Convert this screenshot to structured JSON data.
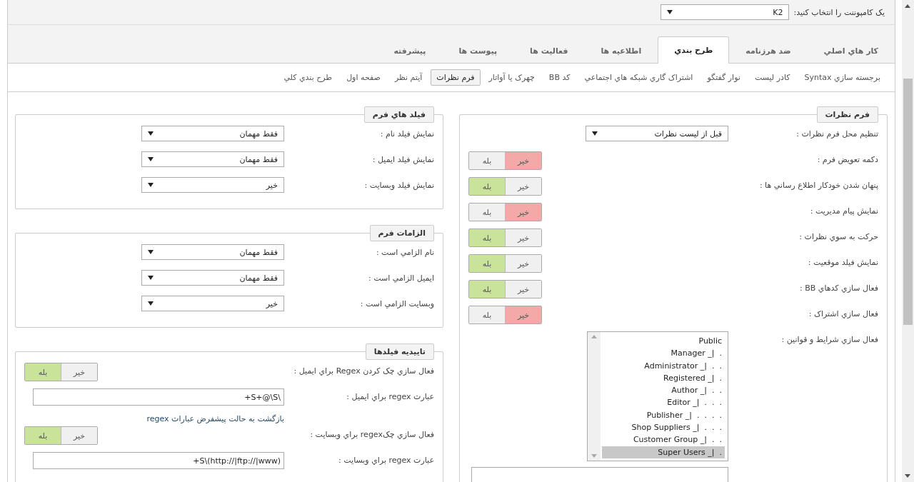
{
  "component_picker": {
    "label": "يک کامپوننت را انتخاب کنيد:",
    "value": "K2"
  },
  "tabs": [
    {
      "label": "کار هاي اصلي",
      "selected": false
    },
    {
      "label": "ضد هرزنامه",
      "selected": false
    },
    {
      "label": "طرح بندي",
      "selected": true
    },
    {
      "label": "اطلاعيه ها",
      "selected": false
    },
    {
      "label": "فعاليت ها",
      "selected": false
    },
    {
      "label": "پيوست ها",
      "selected": false
    },
    {
      "label": "پيشرفته",
      "selected": false
    }
  ],
  "subtabs": [
    {
      "label": "برجسته سازي Syntax",
      "selected": false
    },
    {
      "label": "کادر ليست",
      "selected": false
    },
    {
      "label": "نوار گفتگو",
      "selected": false
    },
    {
      "label": "اشتراک گاري شبکه هاي اجتماعي",
      "selected": false
    },
    {
      "label": "کد BB",
      "selected": false
    },
    {
      "label": "چهرک يا آواتار",
      "selected": false
    },
    {
      "label": "فرم نظرات",
      "selected": true
    },
    {
      "label": "آيتم نظر",
      "selected": false
    },
    {
      "label": "صفحه اول",
      "selected": false
    },
    {
      "label": "طرح بندي کلي",
      "selected": false
    }
  ],
  "right_column": [
    {
      "legend": "فرم نظرات",
      "rows": [
        {
          "kind": "select",
          "label": "تنظيم محل فرم نظرات :",
          "value": "قبل از ليست نظرات"
        },
        {
          "kind": "toggle",
          "label": "دکمه تعويض فرم :",
          "options": [
            {
              "label": "خير",
              "selected": true
            },
            {
              "label": "بله",
              "selected": false
            }
          ]
        },
        {
          "kind": "toggle",
          "label": "پنهان شدن خودکار اطلاع رساني ها :",
          "options": [
            {
              "label": "خير",
              "selected": false
            },
            {
              "label": "بله",
              "selected": true
            }
          ]
        },
        {
          "kind": "toggle",
          "label": "نمايش پيام مديريت :",
          "options": [
            {
              "label": "خير",
              "selected": true
            },
            {
              "label": "بله",
              "selected": false
            }
          ]
        },
        {
          "kind": "toggle",
          "label": "حرکت به سوي نظرات :",
          "options": [
            {
              "label": "خير",
              "selected": false
            },
            {
              "label": "بله",
              "selected": true
            }
          ]
        },
        {
          "kind": "toggle",
          "label": "نمايش فيلد موقعيت :",
          "options": [
            {
              "label": "خير",
              "selected": false
            },
            {
              "label": "بله",
              "selected": true
            }
          ]
        },
        {
          "kind": "toggle",
          "label": "فعال سازي کدهاي BB :",
          "options": [
            {
              "label": "خير",
              "selected": false
            },
            {
              "label": "بله",
              "selected": true
            }
          ]
        },
        {
          "kind": "toggle",
          "label": "فعال سازي اشتراک :",
          "options": [
            {
              "label": "خير",
              "selected": true
            },
            {
              "label": "بله",
              "selected": false
            }
          ]
        },
        {
          "kind": "listbox",
          "label": "فعال سازي شرايط و قوانين :",
          "items": [
            {
              "text": "Public",
              "selected": false
            },
            {
              "text": ".  |_ Manager",
              "selected": false
            },
            {
              "text": ".  .  |_ Administrator",
              "selected": false
            },
            {
              "text": ".  |_ Registered",
              "selected": false
            },
            {
              "text": ".  .  |_ Author",
              "selected": false
            },
            {
              "text": ".  .  .  |_ Editor",
              "selected": false
            },
            {
              "text": ".  .  .  .  |_ Publisher",
              "selected": false
            },
            {
              "text": ".  .  .  |_ Shop Suppliers",
              "selected": false
            },
            {
              "text": ".  .  |_ Customer Group",
              "selected": false
            },
            {
              "text": ".  |_ Super Users",
              "selected": true
            }
          ]
        },
        {
          "kind": "field"
        }
      ]
    }
  ],
  "left_column": [
    {
      "legend": "فيلد هاي فرم",
      "rows": [
        {
          "kind": "select",
          "label": "نمايش فيلد نام :",
          "value": "فقط مهمان"
        },
        {
          "kind": "select",
          "label": "نمايش فيلد ايميل :",
          "value": "فقط مهمان"
        },
        {
          "kind": "select",
          "label": "نمايش فيلد وبسايت :",
          "value": "خير"
        }
      ]
    },
    {
      "legend": "الزامات فرم",
      "rows": [
        {
          "kind": "select",
          "label": "نام الزامي است :",
          "value": "فقط مهمان"
        },
        {
          "kind": "select",
          "label": "ايميل الزامي است :",
          "value": "فقط مهمان"
        },
        {
          "kind": "select",
          "label": "وبسايت الزامي است :",
          "value": "خير"
        }
      ]
    },
    {
      "legend": "تاييديه فيلدها",
      "rows": [
        {
          "kind": "toggle",
          "label": "فعال سازي چک کردن Regex براي ايميل :",
          "options": [
            {
              "label": "خير",
              "selected": false
            },
            {
              "label": "بله",
              "selected": true
            }
          ]
        },
        {
          "kind": "text",
          "label": "عبارت regex براي ايميل :",
          "value": "\\S+@\\S+"
        },
        {
          "kind": "link",
          "text": "بازگشت به حالت پيشفرض عبارات regex"
        },
        {
          "kind": "toggle",
          "label": "فعال سازي چکregex براي وبسايت :",
          "options": [
            {
              "label": "خير",
              "selected": false
            },
            {
              "label": "بله",
              "selected": true
            }
          ]
        },
        {
          "kind": "text",
          "label": "عبارت regex براي وبسايت :",
          "value": "(http://|ftp://|www)\\S+"
        }
      ]
    }
  ]
}
